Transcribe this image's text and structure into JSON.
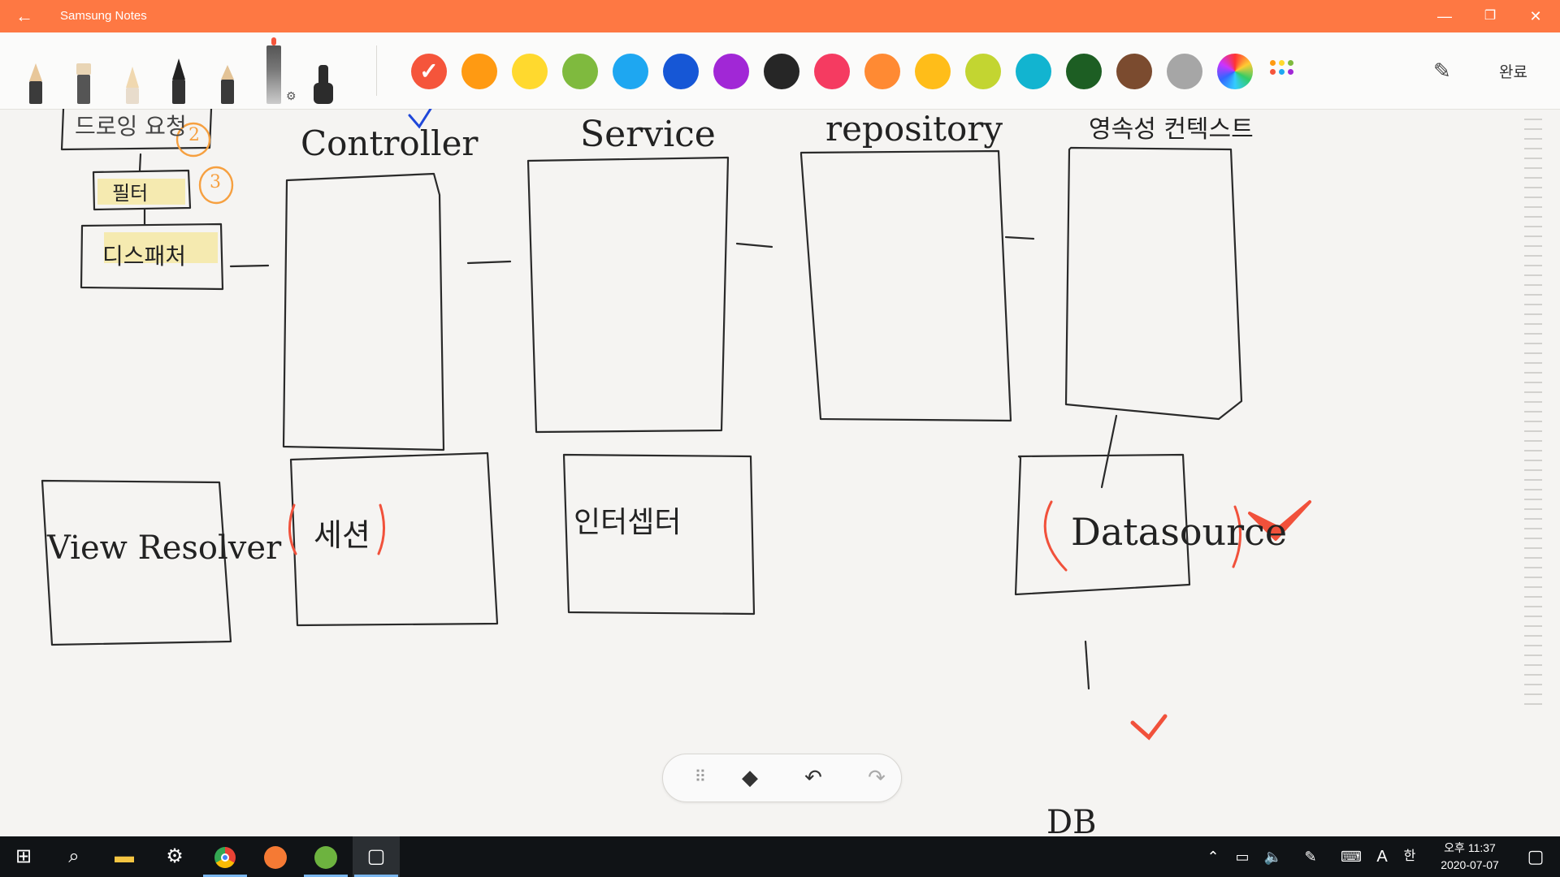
{
  "titlebar": {
    "back_icon": "arrow-left-icon",
    "title": "Samsung Notes",
    "minimize": "—",
    "restore": "❐",
    "close": "✕"
  },
  "toolbar": {
    "pens": [
      "pencil-icon",
      "marker-icon",
      "brush-icon",
      "fountain-pen-icon",
      "calligraphy-pen-icon",
      "pen-settings-icon",
      "ink-pen-icon"
    ],
    "colors": [
      "#f5553b",
      "#ff9a12",
      "#ffd92e",
      "#7fba3e",
      "#1ea7f1",
      "#1657d6",
      "#a127d6",
      "#262626",
      "#f53b61",
      "#ff8a33",
      "#ffbd19",
      "#c3d531",
      "#12b4d0",
      "#1d5e23",
      "#7b4b2f",
      "#a6a6a6"
    ],
    "selected_color_index": 0,
    "more_colors_icon": "more-colors-icon",
    "eyedropper_icon": "eyedropper-icon",
    "done_label": "완료"
  },
  "note": {
    "labels": {
      "top_left_box": "드로잉 요청",
      "filter": "필터",
      "dispatcher": "디스패처",
      "controller": "Controller",
      "service": "Service",
      "repository": "repository",
      "persistence_context": "영속성 컨텍스트",
      "view_resolver": "View Resolver",
      "session": "세션",
      "interceptor": "인터셉터",
      "datasource": "Datasource",
      "db": "DB",
      "badge_2": "2",
      "badge_3": "3"
    }
  },
  "floating_toolbar": {
    "drag_icon": "drag-handle-icon",
    "eraser_icon": "eraser-icon",
    "undo_icon": "undo-icon",
    "redo_icon": "redo-icon"
  },
  "taskbar": {
    "apps": [
      "windows-start-icon",
      "search-icon",
      "file-explorer-icon",
      "settings-icon",
      "chrome-icon",
      "orange-app-icon",
      "spring-app-icon",
      "samsung-notes-icon"
    ],
    "tray": {
      "ime_mode": "A",
      "lang": "한"
    },
    "clock_time": "오후 11:37",
    "clock_date": "2020-07-07"
  }
}
